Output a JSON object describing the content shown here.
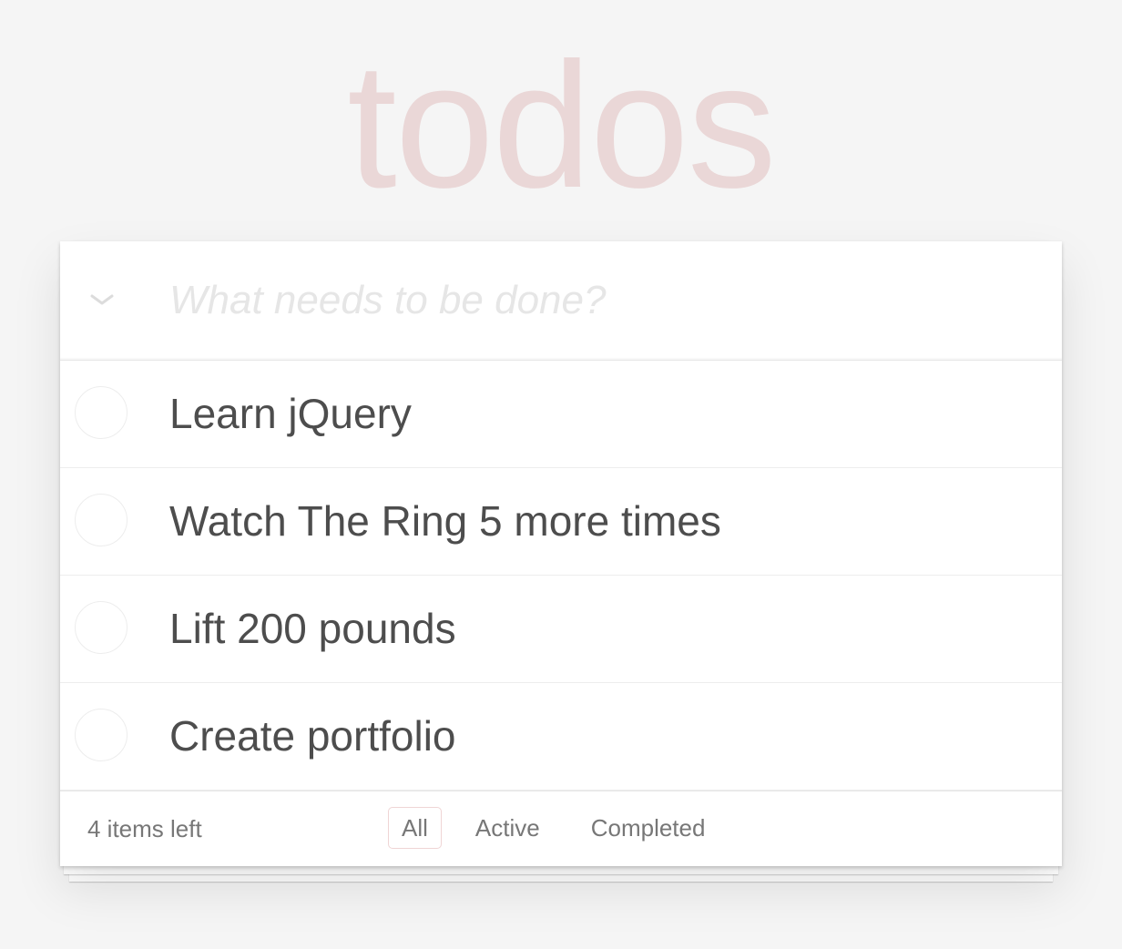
{
  "app": {
    "title": "todos"
  },
  "new_todo": {
    "placeholder": "What needs to be done?",
    "value": ""
  },
  "todos": [
    {
      "label": "Learn jQuery",
      "completed": false
    },
    {
      "label": "Watch The Ring 5 more times",
      "completed": false
    },
    {
      "label": "Lift 200 pounds",
      "completed": false
    },
    {
      "label": "Create portfolio",
      "completed": false
    }
  ],
  "footer": {
    "count_text": "4 items left",
    "filters": [
      {
        "label": "All",
        "selected": true
      },
      {
        "label": "Active",
        "selected": false
      },
      {
        "label": "Completed",
        "selected": false
      }
    ]
  },
  "colors": {
    "title": "#efd5d5",
    "text": "#4d4d4d",
    "footer_text": "#777777",
    "placeholder": "#e6e6e6",
    "background": "#f5f5f5"
  },
  "icons": {
    "toggle_all": "chevron-down-icon",
    "todo_toggle": "circle-checkbox-icon"
  }
}
